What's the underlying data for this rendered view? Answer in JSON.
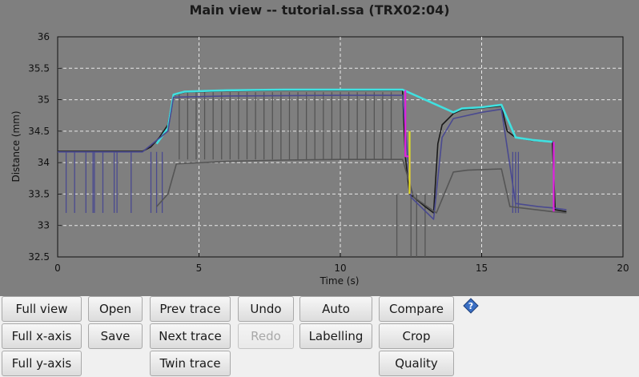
{
  "window": {
    "title": "Main view -- tutorial.ssa (TRX02:04)"
  },
  "chart_data": {
    "type": "line",
    "title": "Main view -- tutorial.ssa (TRX02:04)",
    "xlabel": "Time (s)",
    "ylabel": "Distance (mm)",
    "xlim": [
      0,
      20
    ],
    "ylim": [
      32.5,
      36
    ],
    "xticks": [
      "0",
      "5",
      "10",
      "15",
      "20"
    ],
    "yticks": [
      "32.5",
      "33",
      "33.5",
      "34",
      "34.5",
      "35",
      "35.5",
      "36"
    ],
    "grid": true,
    "background": "#7f7f7f",
    "series": [
      {
        "color": "#1a1a1a",
        "x": [
          0,
          3.0,
          3.3,
          3.6,
          3.9,
          4.1,
          4.5,
          6,
          8,
          10,
          12.2,
          12.3,
          12.45,
          12.6,
          13.0,
          13.3,
          13.45,
          13.6,
          14.0,
          14.3,
          15.0,
          15.7,
          15.9,
          16.2,
          16.8,
          17.5,
          17.6,
          18.0
        ],
        "y": [
          34.18,
          34.18,
          34.25,
          34.4,
          34.6,
          35.07,
          35.12,
          35.14,
          35.15,
          35.15,
          35.15,
          34.1,
          33.5,
          33.45,
          33.3,
          33.2,
          34.3,
          34.6,
          34.78,
          34.84,
          34.87,
          34.9,
          34.5,
          34.4,
          34.35,
          34.33,
          33.25,
          33.22
        ]
      },
      {
        "color": "#40e0e0",
        "x": [
          3.5,
          3.9,
          4.1,
          4.5,
          6,
          8,
          10,
          12.2,
          14.0,
          14.3,
          15.0,
          15.7,
          16.2,
          16.8,
          17.5
        ],
        "y": [
          34.3,
          34.55,
          35.08,
          35.13,
          35.15,
          35.16,
          35.16,
          35.16,
          34.8,
          34.86,
          34.88,
          34.92,
          34.4,
          34.36,
          34.33
        ]
      },
      {
        "color": "#4a4a90",
        "x": [
          0,
          3.0,
          3.9,
          4.1,
          6,
          10,
          12.2,
          12.5,
          13.3,
          13.6,
          14.0,
          15.0,
          15.7,
          16.2,
          17.0,
          17.5,
          18.0
        ],
        "y": [
          34.17,
          34.17,
          34.5,
          35.04,
          35.06,
          35.07,
          35.07,
          33.45,
          33.1,
          34.4,
          34.7,
          34.8,
          34.85,
          33.35,
          33.3,
          33.28,
          33.25
        ]
      },
      {
        "color": "#555555",
        "x": [
          3.5,
          3.9,
          4.2,
          6,
          8,
          10,
          12.2,
          12.6,
          13.4,
          14.0,
          14.5,
          15.7,
          16.0,
          17.5,
          18.0
        ],
        "y": [
          33.3,
          33.5,
          33.98,
          34.02,
          34.04,
          34.05,
          34.05,
          33.45,
          33.2,
          33.85,
          33.88,
          33.9,
          33.3,
          33.22,
          33.2
        ]
      },
      {
        "color": "#e020e0",
        "x": [
          12.3,
          12.3,
          12.45,
          12.45
        ],
        "y": [
          35.15,
          34.1,
          34.1,
          33.5
        ]
      },
      {
        "color": "#e020e0",
        "x": [
          17.55,
          17.55
        ],
        "y": [
          34.33,
          33.22
        ]
      },
      {
        "color": "#e0e020",
        "x": [
          12.45,
          12.45
        ],
        "y": [
          34.5,
          33.5
        ]
      }
    ],
    "spikes": [
      {
        "color": "#4a4a90",
        "x": [
          0.3,
          0.6,
          1.0,
          1.25,
          1.3,
          1.6,
          2.0,
          2.1,
          2.6,
          3.3,
          3.5,
          3.7,
          16.1,
          16.2,
          16.3
        ],
        "to": 33.2
      },
      {
        "color": "#555555",
        "x": [
          4.3,
          4.6,
          4.9,
          5.2,
          5.5,
          5.8,
          6.1,
          6.4,
          6.7,
          7.0,
          7.3,
          7.6,
          7.9,
          8.2,
          8.5,
          8.8,
          9.1,
          9.4,
          9.7,
          10.0,
          10.3,
          10.6,
          10.9,
          11.2,
          11.5,
          11.8
        ],
        "from": 34.05,
        "to": 35.12
      },
      {
        "color": "#555555",
        "x": [
          12.0,
          12.5,
          12.7,
          13.0
        ],
        "from": 33.5,
        "to": 32.5
      }
    ]
  },
  "toolbar": {
    "full_view": "Full view",
    "full_x_axis": "Full x-axis",
    "full_y_axis": "Full y-axis",
    "open": "Open",
    "save": "Save",
    "prev_trace": "Prev trace",
    "next_trace": "Next trace",
    "twin_trace": "Twin trace",
    "undo": "Undo",
    "redo": "Redo",
    "auto": "Auto",
    "labelling": "Labelling",
    "compare": "Compare",
    "crop": "Crop",
    "quality": "Quality",
    "help_icon": "help-icon"
  }
}
